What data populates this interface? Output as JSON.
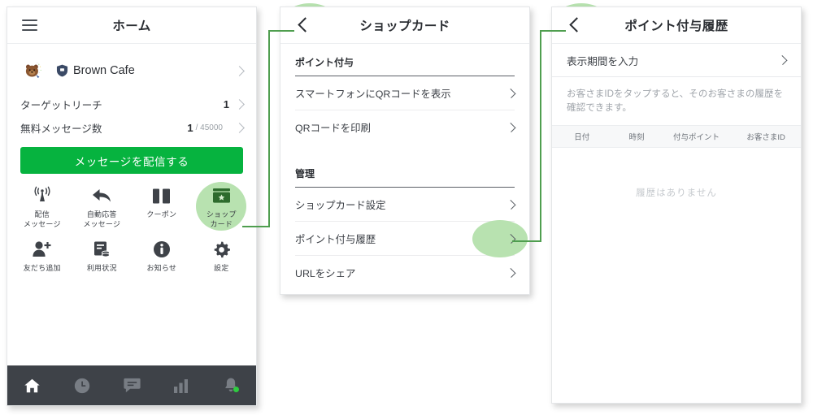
{
  "colors": {
    "line_green": "#06b33f",
    "highlight_green": "#b8e2b0",
    "connector_green": "#4f9e4f",
    "tabbar_dark": "#3e4248",
    "card_icon_green": "#2d6b2d"
  },
  "home": {
    "header": {
      "title": "ホーム",
      "menu_icon": "hamburger-icon"
    },
    "profile": {
      "name": "Brown Cafe",
      "badge_icon": "shield-badge-icon",
      "avatar_icon": "brown-bear-avatar"
    },
    "stats": [
      {
        "label": "ターゲットリーチ",
        "value": "1",
        "sub": ""
      },
      {
        "label": "無料メッセージ数",
        "value": "1",
        "sub": "/ 45000"
      }
    ],
    "cta_label": "メッセージを配信する",
    "grid": [
      {
        "label": "配信\nメッセージ",
        "icon": "broadcast-antenna-icon",
        "highlighted": false
      },
      {
        "label": "自動応答\nメッセージ",
        "icon": "reply-arrow-icon",
        "highlighted": false
      },
      {
        "label": "クーポン",
        "icon": "coupon-ticket-icon",
        "highlighted": false
      },
      {
        "label": "ショップ\nカード",
        "icon": "shop-card-icon",
        "highlighted": true
      },
      {
        "label": "友だち追加",
        "icon": "add-friend-icon",
        "highlighted": false
      },
      {
        "label": "利用状況",
        "icon": "usage-report-icon",
        "highlighted": false
      },
      {
        "label": "お知らせ",
        "icon": "info-circle-icon",
        "highlighted": false
      },
      {
        "label": "設定",
        "icon": "gear-icon",
        "highlighted": false
      }
    ],
    "tabs": [
      {
        "icon": "home-icon",
        "active": true,
        "badge": false
      },
      {
        "icon": "clock-icon",
        "active": false,
        "badge": false
      },
      {
        "icon": "chat-bubble-icon",
        "active": false,
        "badge": false
      },
      {
        "icon": "bar-chart-icon",
        "active": false,
        "badge": false
      },
      {
        "icon": "bell-icon",
        "active": false,
        "badge": true
      }
    ]
  },
  "shopcard": {
    "header": {
      "title": "ショップカード",
      "back_icon": "back-chevron-icon"
    },
    "sections": [
      {
        "title": "ポイント付与",
        "rows": [
          {
            "label": "スマートフォンにQRコードを表示",
            "highlighted": false
          },
          {
            "label": "QRコードを印刷",
            "highlighted": false
          }
        ]
      },
      {
        "title": "管理",
        "rows": [
          {
            "label": "ショップカード設定",
            "highlighted": false
          },
          {
            "label": "ポイント付与履歴",
            "highlighted": true
          },
          {
            "label": "URLをシェア",
            "highlighted": false
          }
        ]
      }
    ]
  },
  "history": {
    "header": {
      "title": "ポイント付与履歴",
      "back_icon": "back-chevron-icon"
    },
    "period_row_label": "表示期間を入力",
    "note": "お客さまIDをタップすると、そのお客さまの履歴を確認できます。",
    "table": {
      "columns": [
        "日付",
        "時刻",
        "付与ポイント",
        "お客さまID"
      ],
      "rows": [],
      "empty_text": "履歴はありません"
    }
  }
}
